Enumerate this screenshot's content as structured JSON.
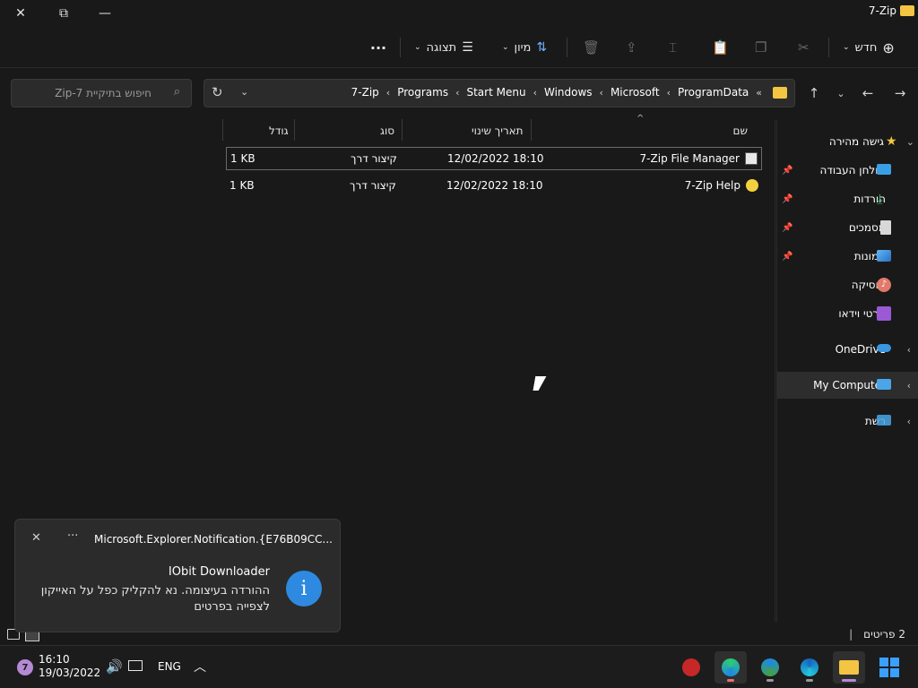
{
  "window": {
    "title": "7-Zip"
  },
  "toolbar": {
    "new_label": "חדש",
    "sort_label": "מיון",
    "view_label": "תצוגה",
    "more_label": "···"
  },
  "address": {
    "crumbs": [
      "ProgramData",
      "Microsoft",
      "Windows",
      "Start Menu",
      "Programs",
      "7-Zip"
    ],
    "overflow": "«"
  },
  "search": {
    "placeholder": "חיפוש בתיקיית 7-Zip"
  },
  "nav": {
    "quick_access": "גישה מהירה",
    "items": [
      {
        "label": "שולחן העבודה",
        "pinned": true
      },
      {
        "label": "הורדות",
        "pinned": true
      },
      {
        "label": "מסמכים",
        "pinned": true
      },
      {
        "label": "תמונות",
        "pinned": true
      },
      {
        "label": "מוסיקה",
        "pinned": false
      },
      {
        "label": "סרטי וידאו",
        "pinned": false
      }
    ],
    "onedrive": "OneDrive",
    "my_computer": "My Computer",
    "network": "רשת"
  },
  "columns": {
    "name": "שם",
    "date": "תאריך שינוי",
    "type": "סוג",
    "size": "גודל"
  },
  "files": [
    {
      "name": "7-Zip File Manager",
      "date": "12/02/2022 18:10",
      "type": "קיצור דרך",
      "size": "1 KB"
    },
    {
      "name": "7-Zip Help",
      "date": "12/02/2022 18:10",
      "type": "קיצור דרך",
      "size": "1 KB"
    }
  ],
  "status": {
    "count": "2 פריטים"
  },
  "notification": {
    "app": "Microsoft.Explorer.Notification.{E76B09CC...",
    "title": "IObit Downloader",
    "body": "ההורדה בעיצומה. נא להקליק כפל על האייקון לצפייה בפרטים"
  },
  "taskbar": {
    "time": "16:10",
    "date": "19/03/2022",
    "lang": "ENG",
    "badge": "7"
  },
  "colors": {
    "folder": "#f4c542",
    "accent": "#2d8ae0"
  }
}
